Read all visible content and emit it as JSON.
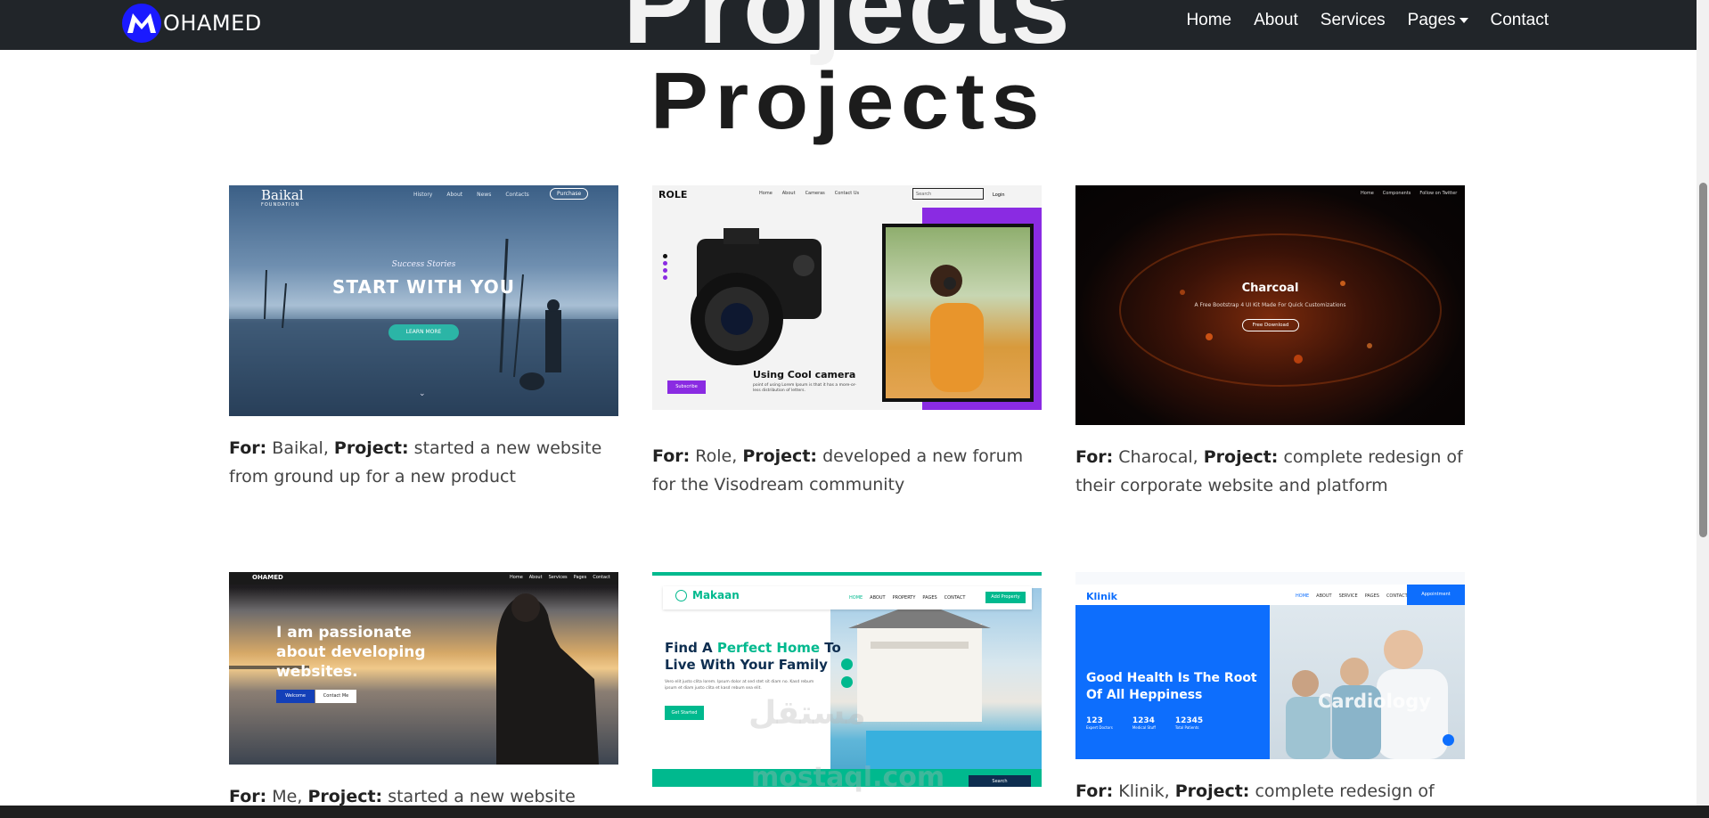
{
  "navbar": {
    "brand_letter": "M",
    "brand_text": "OHAMED",
    "links": [
      "Home",
      "About",
      "Services",
      "Pages",
      "Contact"
    ]
  },
  "section": {
    "ghost_title": "Projects",
    "title": "Projects"
  },
  "projects": [
    {
      "for_label": "For:",
      "client": "Baikal,",
      "project_label": "Project:",
      "desc": "started a new website from ground up for a new product",
      "thumb": {
        "tagline": "Success Stories",
        "headline": "START WITH YOU",
        "button": "LEARN MORE",
        "logo": "Baikal",
        "logo_sub": "FOUNDATION",
        "menu": [
          "History",
          "About",
          "News",
          "Contacts"
        ],
        "cta": "Purchase"
      }
    },
    {
      "for_label": "For:",
      "client": "Role,",
      "project_label": "Project:",
      "desc": "developed a new forum for the Visodream community",
      "thumb": {
        "logo": "ROLE",
        "menu": [
          "Home",
          "About",
          "Cameras",
          "Contact Us"
        ],
        "search": "Search",
        "login": "Login",
        "headline": "Using Cool camera",
        "button": "Subscribe",
        "body": "point of using Lorem Ipsum is that it has a more-or-less distribution of letters."
      }
    },
    {
      "for_label": "For:",
      "client": "Charocal,",
      "project_label": "Project:",
      "desc": "complete redesign of their corporate website and platform",
      "thumb": {
        "headline": "Charcoal",
        "sub": "A Free Bootstrap 4 UI Kit Made For Quick Customizations",
        "button": "Free Download",
        "menu": [
          "Home",
          "Components",
          "Follow on Twitter"
        ]
      }
    },
    {
      "for_label": "For:",
      "client": "Me,",
      "project_label": "Project:",
      "desc": "started a new website from",
      "thumb": {
        "brand": "OHAMED",
        "headline_1": "I am passionate",
        "headline_2": "about developing",
        "headline_3": "websites.",
        "button_1": "Welcome",
        "button_2": "Contact Me",
        "menu": [
          "Home",
          "About",
          "Services",
          "Pages",
          "Contact"
        ]
      }
    },
    {
      "for_label": "",
      "client": "",
      "project_label": "",
      "desc": "",
      "thumb": {
        "logo": "Makaan",
        "menu": [
          "HOME",
          "ABOUT",
          "PROPERTY",
          "PAGES",
          "CONTACT"
        ],
        "cta": "Add Property",
        "headline_1": "Find A ",
        "headline_accent": "Perfect Home",
        "headline_2": " To",
        "headline_3": "Live With Your Family",
        "body": "Vero elit justo clita lorem. Ipsum dolor at sed stet sit diam no. Kasd rebum ipsum et diam justo clita et kasd rebum sea elit.",
        "button": "Get Started",
        "search_button": "Search"
      }
    },
    {
      "for_label": "For:",
      "client": "Klinik,",
      "project_label": "Project:",
      "desc": "complete redesign of their",
      "thumb": {
        "logo": "Klinik",
        "menu": [
          "HOME",
          "ABOUT",
          "SERVICE",
          "PAGES",
          "CONTACT"
        ],
        "cta": "Appointment",
        "headline_1": "Good Health Is The Root",
        "headline_2": "Of All Heppiness",
        "stats": [
          {
            "value": "123",
            "label": "Expert Doctors"
          },
          {
            "value": "1234",
            "label": "Medical Stuff"
          },
          {
            "value": "12345",
            "label": "Total Patients"
          }
        ],
        "overlay": "Cardiology"
      }
    }
  ],
  "watermark": {
    "line1": "مستقل",
    "line2": "mostaql.com"
  }
}
